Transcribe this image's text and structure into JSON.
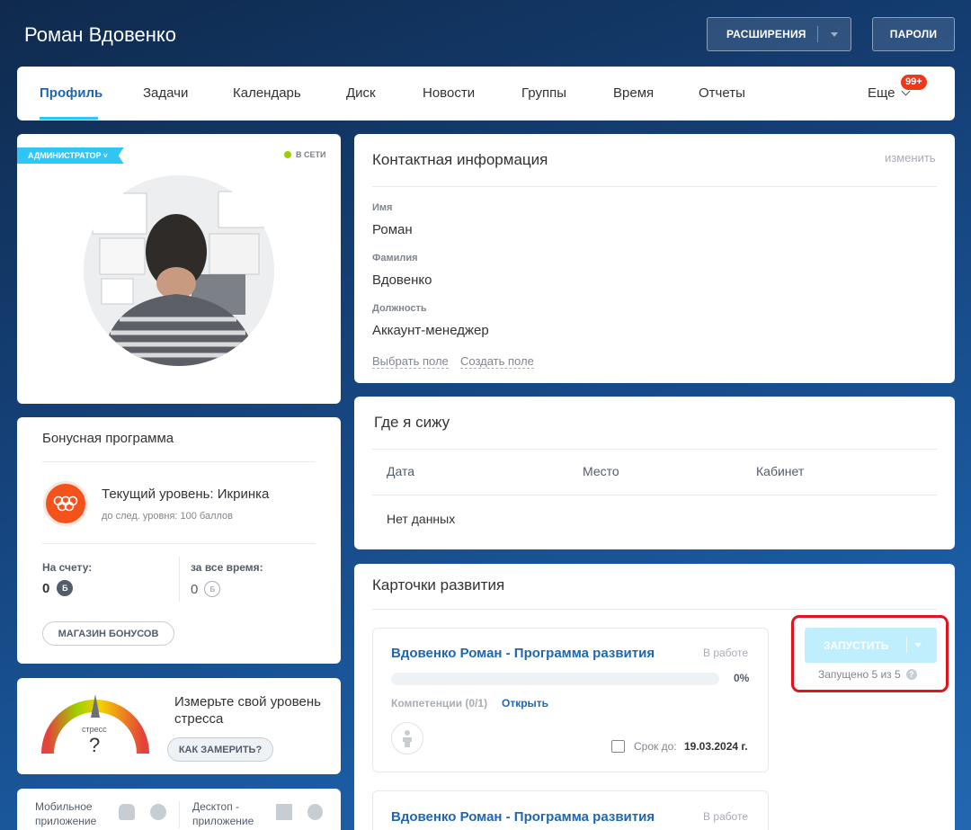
{
  "header": {
    "user_name": "Роман Вдовенко",
    "extensions_label": "РАСШИРЕНИЯ",
    "passwords_label": "ПАРОЛИ"
  },
  "nav": {
    "items": [
      {
        "label": "Профиль",
        "active": true
      },
      {
        "label": "Задачи"
      },
      {
        "label": "Календарь"
      },
      {
        "label": "Диск"
      },
      {
        "label": "Новости"
      },
      {
        "label": "Группы"
      },
      {
        "label": "Время"
      },
      {
        "label": "Отчеты"
      }
    ],
    "more_label": "Еще",
    "more_badge": "99+"
  },
  "profile_card": {
    "role_badge": "АДМИНИСТРАТОР",
    "status": "В СЕТИ"
  },
  "bonus": {
    "title": "Бонусная программа",
    "level_text": "Текущий уровень: Икринка",
    "next_level_text": "до след. уровня: 100 баллов",
    "balance_label": "На счету:",
    "balance_value": "0",
    "balance_unit": "Б",
    "total_label": "за все время:",
    "total_value": "0",
    "total_unit": "Б",
    "shop_button": "МАГАЗИН БОНУСОВ"
  },
  "stress": {
    "gauge_label": "стресс",
    "gauge_value": "?",
    "text": "Измерьте свой уровень стресса",
    "measure_button": "КАК ЗАМЕРИТЬ?"
  },
  "apps": {
    "mobile_label": "Мобильное приложение",
    "desktop_label": "Десктоп - приложение"
  },
  "contact": {
    "title": "Контактная информация",
    "edit_link": "изменить",
    "fields": [
      {
        "label": "Имя",
        "value": "Роман"
      },
      {
        "label": "Фамилия",
        "value": "Вдовенко"
      },
      {
        "label": "Должность",
        "value": "Аккаунт-менеджер"
      }
    ],
    "choose_field": "Выбрать поле",
    "create_field": "Создать поле"
  },
  "seat": {
    "title": "Где я сижу",
    "columns": [
      "Дата",
      "Место",
      "Кабинет"
    ],
    "empty_text": "Нет данных"
  },
  "development": {
    "title": "Карточки развития",
    "cards": [
      {
        "name": "Вдовенко Роман - Программа развития",
        "status": "В работе",
        "progress_label": "0%",
        "progress": 0,
        "competencies": "Компетенции (0/1)",
        "open_link": "Открыть",
        "deadline_label": "Срок до:",
        "deadline": "19.03.2024 г."
      },
      {
        "name": "Вдовенко Роман - Программа развития",
        "status": "В работе"
      }
    ],
    "launch_button": "ЗАПУСТИТЬ",
    "launched_text": "Запущено 5 из 5",
    "help_icon": "?"
  },
  "colors": {
    "accent": "#2fc6f6",
    "link": "#2067b0",
    "highlight_frame": "#e0141d",
    "online": "#9dcf00"
  }
}
